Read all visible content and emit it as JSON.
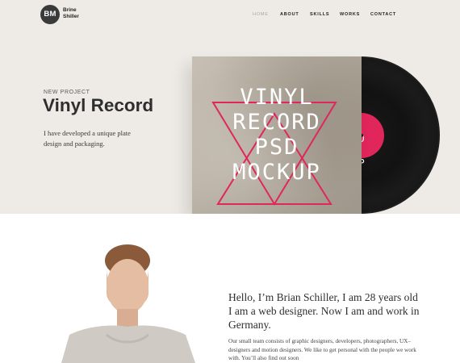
{
  "brand": {
    "initials": "BM",
    "name_line1": "Brine",
    "name_line2": "Shiller"
  },
  "nav": {
    "items": [
      {
        "label": "HOME",
        "active": true
      },
      {
        "label": "ABOUT",
        "active": false
      },
      {
        "label": "SKILLS",
        "active": false
      },
      {
        "label": "WORKS",
        "active": false
      },
      {
        "label": "CONTACT",
        "active": false
      }
    ]
  },
  "hero": {
    "kicker": "NEW PROJECT",
    "title": "Vinyl Record",
    "description": "I have developed a unique plate design and packaging.",
    "sleeve_text": "VINYL\nRECORD\nPSD\nMOCKUP",
    "label_text": "YL\nORD\nD\nKUP",
    "accent_color": "#e0265a"
  },
  "about": {
    "headline": "Hello, I’m Brian Schiller, I am 28 years old I am a web designer. Now I am and work in Germany.",
    "body": "Our small team consists of graphic designers, developers, photographers, UX–designers and motion designers. We like to get personal with the people we work with. You’ll also find out soon"
  }
}
